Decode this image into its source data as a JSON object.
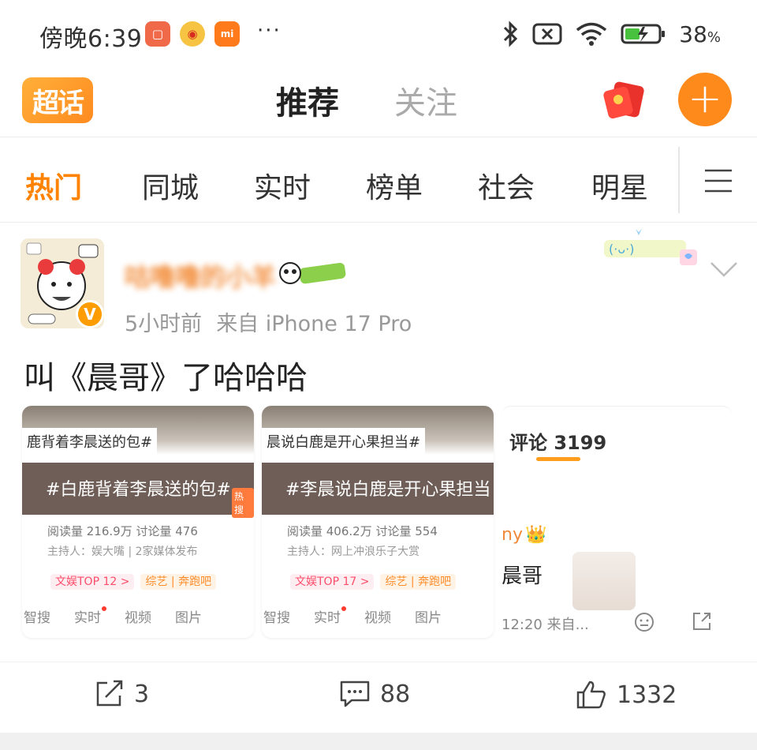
{
  "status_bar": {
    "time": "傍晚6:39",
    "dots": "···",
    "battery": "38",
    "battery_unit": "%",
    "icons": [
      "red-app-icon",
      "weibo-app-icon",
      "mi-app-icon",
      "bluetooth-icon",
      "sim-off-icon",
      "wifi-icon",
      "battery-charging-icon"
    ]
  },
  "header": {
    "logo": "超话",
    "tabs": [
      {
        "label": "推荐",
        "active": true
      },
      {
        "label": "关注",
        "active": false
      }
    ],
    "plus": "+"
  },
  "categories": [
    {
      "label": "热门",
      "active": true
    },
    {
      "label": "同城",
      "active": false
    },
    {
      "label": "实时",
      "active": false
    },
    {
      "label": "榜单",
      "active": false
    },
    {
      "label": "社会",
      "active": false
    },
    {
      "label": "明星",
      "active": false
    }
  ],
  "post": {
    "username": "咕噜噜的小羊",
    "time_ago": "5小时前",
    "source": "来自 iPhone 17 Pro",
    "verified": "V",
    "text": "叫《晨哥》了哈哈哈",
    "images": [
      {
        "hashtag_top": "鹿背着李晨送的包#",
        "band_text": "#白鹿背着李晨送的包#",
        "hot_tag": "热搜",
        "stats": "阅读量 216.9万  讨论量 476",
        "host": "主持人：娱大嘴 | 2家媒体发布",
        "tag1": "文娱TOP 12 >",
        "tag2": "综艺 | 奔跑吧",
        "bar": [
          "智搜",
          "实时",
          "视频",
          "图片"
        ]
      },
      {
        "hashtag_top": "晨说白鹿是开心果担当#",
        "band_text": "#李晨说白鹿是开心果担当",
        "hot_tag": "",
        "stats": "阅读量 406.2万  讨论量 554",
        "host": "主持人：网上冲浪乐子大赏",
        "tag1": "文娱TOP 17 >",
        "tag2": "综艺 | 奔跑吧",
        "bar": [
          "智搜",
          "实时",
          "视频",
          "图片"
        ]
      }
    ],
    "comment_card": {
      "title": "评论 3199",
      "user_fragment": "ny",
      "line": "晨哥",
      "footer": "12:20  来自..."
    }
  },
  "actions": {
    "repost": "3",
    "comment": "88",
    "like": "1332"
  },
  "colors": {
    "accent": "#ff8200",
    "tab_underline": "#ffb400",
    "plus_button": "#ff8a1c"
  }
}
